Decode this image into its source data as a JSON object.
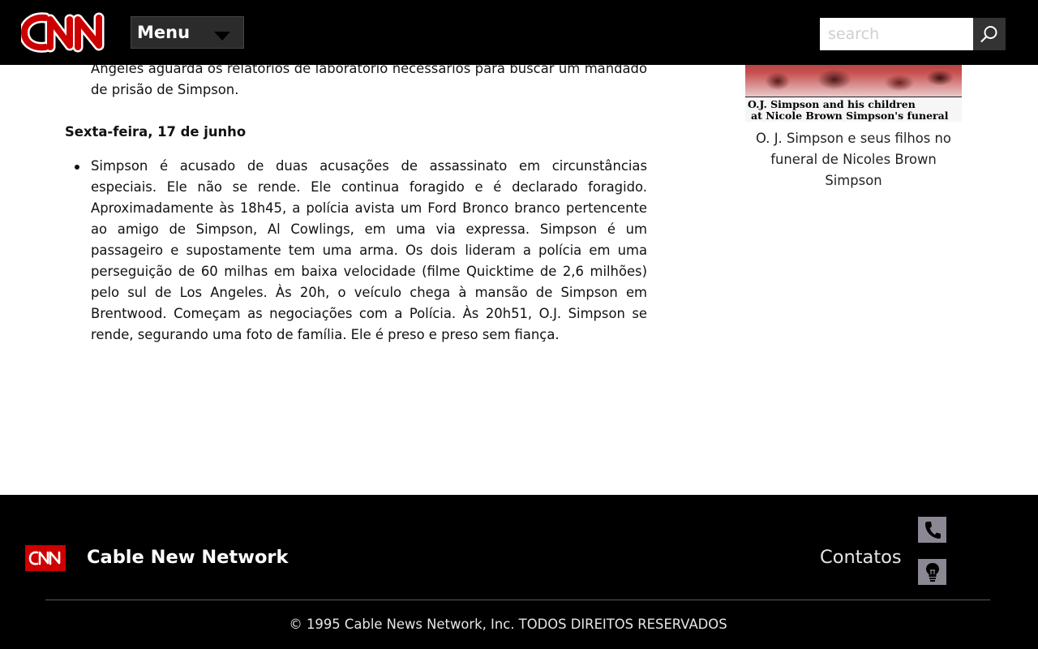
{
  "header": {
    "logo_text": "CNN",
    "menu_label": "Menu",
    "search_placeholder": "search"
  },
  "article": {
    "partial_bullet": "Angeles aguarda os relatórios de laboratório necessários para buscar um mandado de prisão de Simpson.",
    "date_heading": "Sexta-feira, 17 de junho",
    "bullet": "Simpson é acusado de duas acusações de assassinato em circunstâncias especiais. Ele não se rende. Ele continua foragido e é declarado foragido. Aproximadamente às 18h45, a polícia avista um Ford Bronco branco pertencente ao amigo de Simpson, Al Cowlings, em uma via expressa. Simpson é um passageiro e supostamente tem uma arma. Os dois lideram a polícia em uma perseguição de 60 milhas em baixa velocidade (filme Quicktime de 2,6 milhões) pelo sul de Los Angeles. Às 20h, o veículo chega à mansão de Simpson em Brentwood. Começam as negociações com a Polícia. Às 20h51, O.J. Simpson se rende, segurando uma foto de família. Ele é preso e preso sem fiança."
  },
  "sidebar": {
    "photo_overlay_line1": "O.J. Simpson and his children",
    "photo_overlay_line2": "at Nicole Brown Simpson's funeral",
    "figure_caption": "O. J. Simpson e seus filhos no funeral de Nicoles Brown Simpson"
  },
  "footer": {
    "logo_text": "CNN",
    "title": "Cable New Network",
    "contacts_label": "Contatos",
    "icons": [
      "phone-icon",
      "lightbulb-icon"
    ],
    "copyright": "© 1995 Cable News Network, Inc. TODOS DIREITOS RESERVADOS"
  },
  "colors": {
    "header_bg": "#000000",
    "brand_red": "#cc0000",
    "footer_bg": "#000000",
    "contact_icon_bg": "#8b8893"
  }
}
